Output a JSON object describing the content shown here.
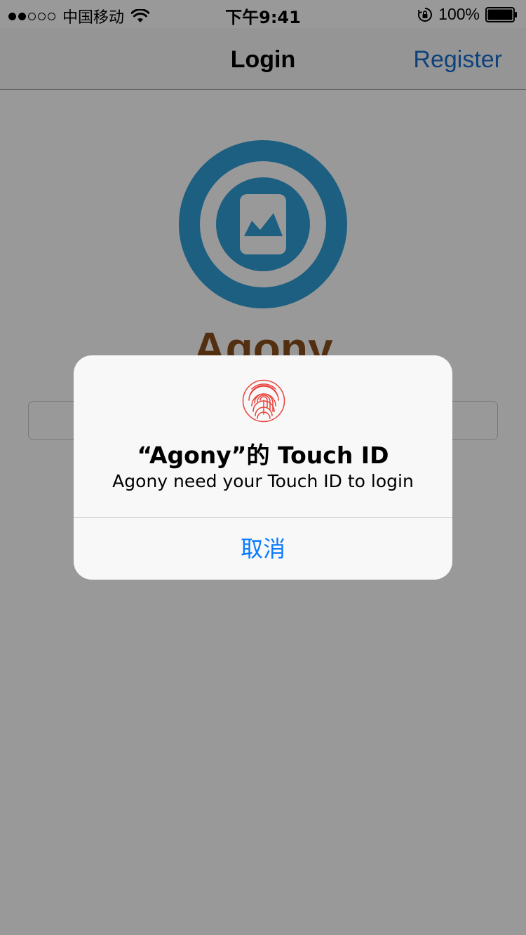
{
  "status_bar": {
    "carrier": "中国移动",
    "time": "下午9:41",
    "battery": "100%"
  },
  "nav": {
    "title": "Login",
    "register_label": "Register"
  },
  "app": {
    "name": "Agony"
  },
  "alert": {
    "title": "“Agony”的 Touch ID",
    "message": "Agony need your Touch ID to login",
    "cancel_label": "取消"
  },
  "colors": {
    "accent": "#1a6fd1",
    "logo_blue": "#2f9ed8",
    "app_name_brown": "#8a4f1e",
    "alert_button": "#0a7aff",
    "fingerprint_red": "#e8433c"
  }
}
